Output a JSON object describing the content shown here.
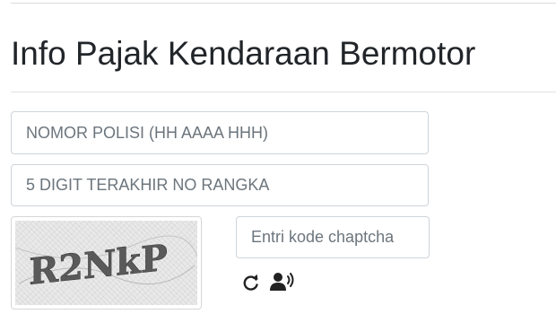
{
  "page": {
    "title": "Info Pajak Kendaraan Bermotor"
  },
  "form": {
    "plate_placeholder": "NOMOR POLISI (HH AAAA HHH)",
    "rangka_placeholder": "5 DIGIT TERAKHIR NO RANGKA",
    "captcha_placeholder": "Entri kode chaptcha",
    "captcha_code": "R2NkP"
  },
  "icons": {
    "refresh": "refresh-icon",
    "audio": "audio-captcha-icon"
  },
  "colors": {
    "text": "#212529",
    "border": "#ced4da",
    "captcha_bg": "#e9e9e9",
    "captcha_text": "#5a5a5a"
  }
}
